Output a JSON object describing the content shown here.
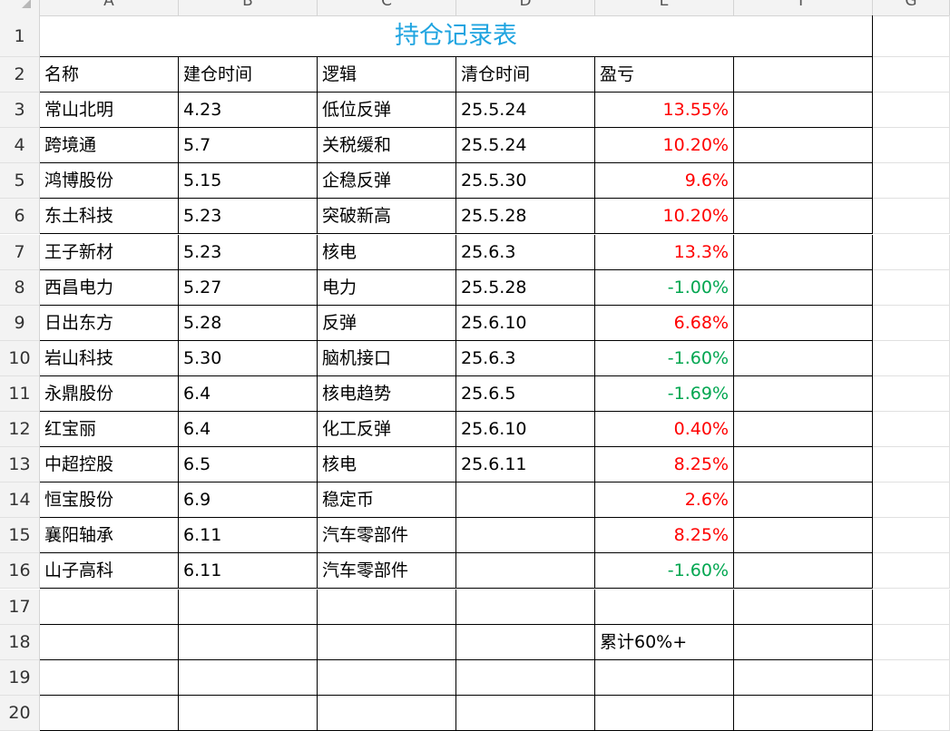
{
  "columns": [
    "A",
    "B",
    "C",
    "D",
    "E",
    "F",
    "G"
  ],
  "row_numbers": [
    "1",
    "2",
    "3",
    "4",
    "5",
    "6",
    "7",
    "8",
    "9",
    "10",
    "11",
    "12",
    "13",
    "14",
    "15",
    "16",
    "17",
    "18",
    "19",
    "20"
  ],
  "sheet": {
    "title": "持仓记录表",
    "headers": [
      "名称",
      "建仓时间",
      "逻辑",
      "清仓时间",
      "盈亏"
    ],
    "rows": [
      {
        "name": "常山北明",
        "open": "4.23",
        "logic": "低位反弹",
        "close": "25.5.24",
        "pnl": "13.55%",
        "sign": "pos"
      },
      {
        "name": "跨境通",
        "open": "5.7",
        "logic": "关税缓和",
        "close": "25.5.24",
        "pnl": "10.20%",
        "sign": "pos"
      },
      {
        "name": "鸿博股份",
        "open": "5.15",
        "logic": "企稳反弹",
        "close": "25.5.30",
        "pnl": "9.6%",
        "sign": "pos"
      },
      {
        "name": "东土科技",
        "open": "5.23",
        "logic": "突破新高",
        "close": "25.5.28",
        "pnl": "10.20%",
        "sign": "pos"
      },
      {
        "name": "王子新材",
        "open": "5.23",
        "logic": "核电",
        "close": "25.6.3",
        "pnl": "13.3%",
        "sign": "pos"
      },
      {
        "name": "西昌电力",
        "open": "5.27",
        "logic": "电力",
        "close": "25.5.28",
        "pnl": "-1.00%",
        "sign": "neg"
      },
      {
        "name": "日出东方",
        "open": "5.28",
        "logic": "反弹",
        "close": "25.6.10",
        "pnl": "6.68%",
        "sign": "pos"
      },
      {
        "name": "岩山科技",
        "open": "5.30",
        "logic": "脑机接口",
        "close": "25.6.3",
        "pnl": "-1.60%",
        "sign": "neg"
      },
      {
        "name": "永鼎股份",
        "open": "6.4",
        "logic": "核电趋势",
        "close": "25.6.5",
        "pnl": "-1.69%",
        "sign": "neg"
      },
      {
        "name": "红宝丽",
        "open": "6.4",
        "logic": "化工反弹",
        "close": "25.6.10",
        "pnl": "0.40%",
        "sign": "pos"
      },
      {
        "name": "中超控股",
        "open": "6.5",
        "logic": "核电",
        "close": "25.6.11",
        "pnl": "8.25%",
        "sign": "pos"
      },
      {
        "name": "恒宝股份",
        "open": "6.9",
        "logic": "稳定币",
        "close": "",
        "pnl": "2.6%",
        "sign": "pos"
      },
      {
        "name": "襄阳轴承",
        "open": "6.11",
        "logic": "汽车零部件",
        "close": "",
        "pnl": "8.25%",
        "sign": "pos"
      },
      {
        "name": "山子高科",
        "open": "6.11",
        "logic": "汽车零部件",
        "close": "",
        "pnl": "-1.60%",
        "sign": "neg"
      }
    ],
    "summary": "累计60%+"
  },
  "colors": {
    "title": "#1fa4e0",
    "positive": "#ff0000",
    "negative": "#00a650"
  }
}
